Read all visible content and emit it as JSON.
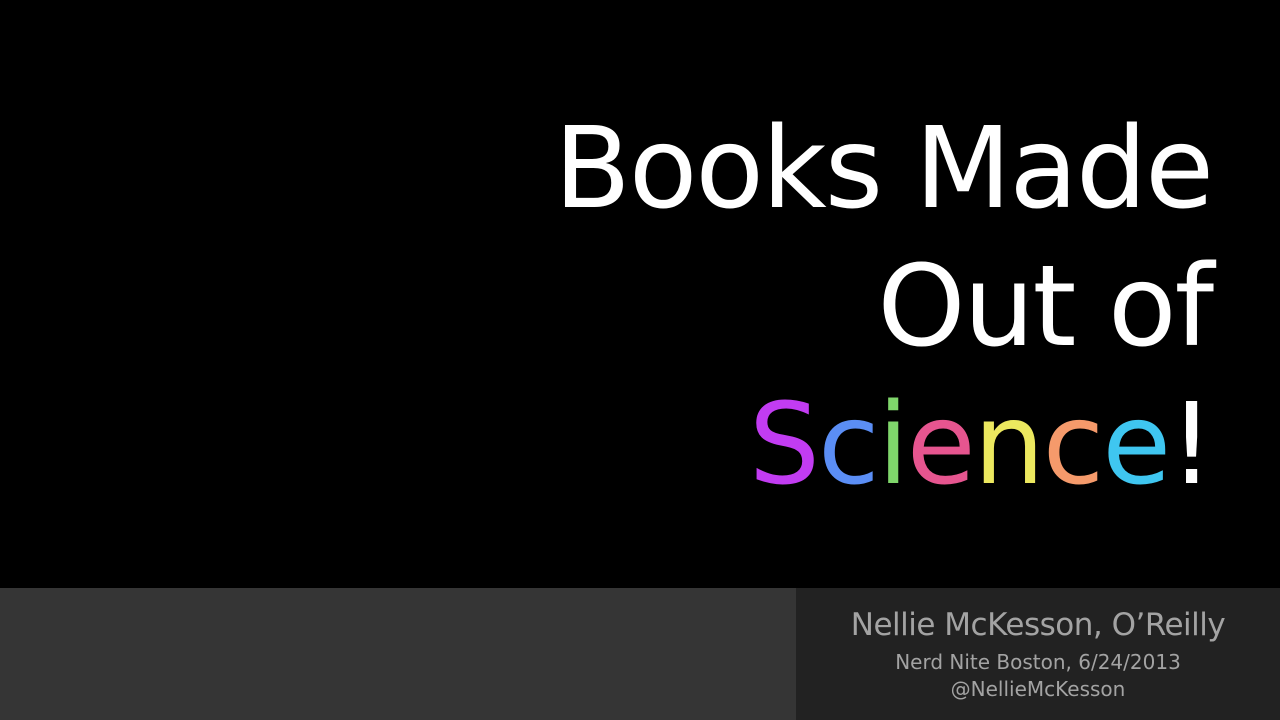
{
  "slide": {
    "title_line_1": "Books Made",
    "title_line_2": "Out of",
    "title_line_3_letters": [
      {
        "char": "S",
        "color": "#c23cf2"
      },
      {
        "char": "c",
        "color": "#5b8ef5"
      },
      {
        "char": "i",
        "color": "#7fd66b"
      },
      {
        "char": "e",
        "color": "#e6558f"
      },
      {
        "char": "n",
        "color": "#ece85f"
      },
      {
        "char": "c",
        "color": "#f59a6b"
      },
      {
        "char": "e",
        "color": "#3fc6f0"
      },
      {
        "char": "!",
        "color": "#ffffff"
      }
    ],
    "footer": {
      "byline": "Nellie McKesson, O’Reilly",
      "event": "Nerd Nite Boston, 6/24/2013",
      "handle": "@NellieMcKesson"
    }
  },
  "colors": {
    "background": "#000000",
    "title_text": "#ffffff",
    "footer_left_bg": "#353535",
    "footer_right_bg": "#222222",
    "footer_text": "#a3a3a3"
  }
}
